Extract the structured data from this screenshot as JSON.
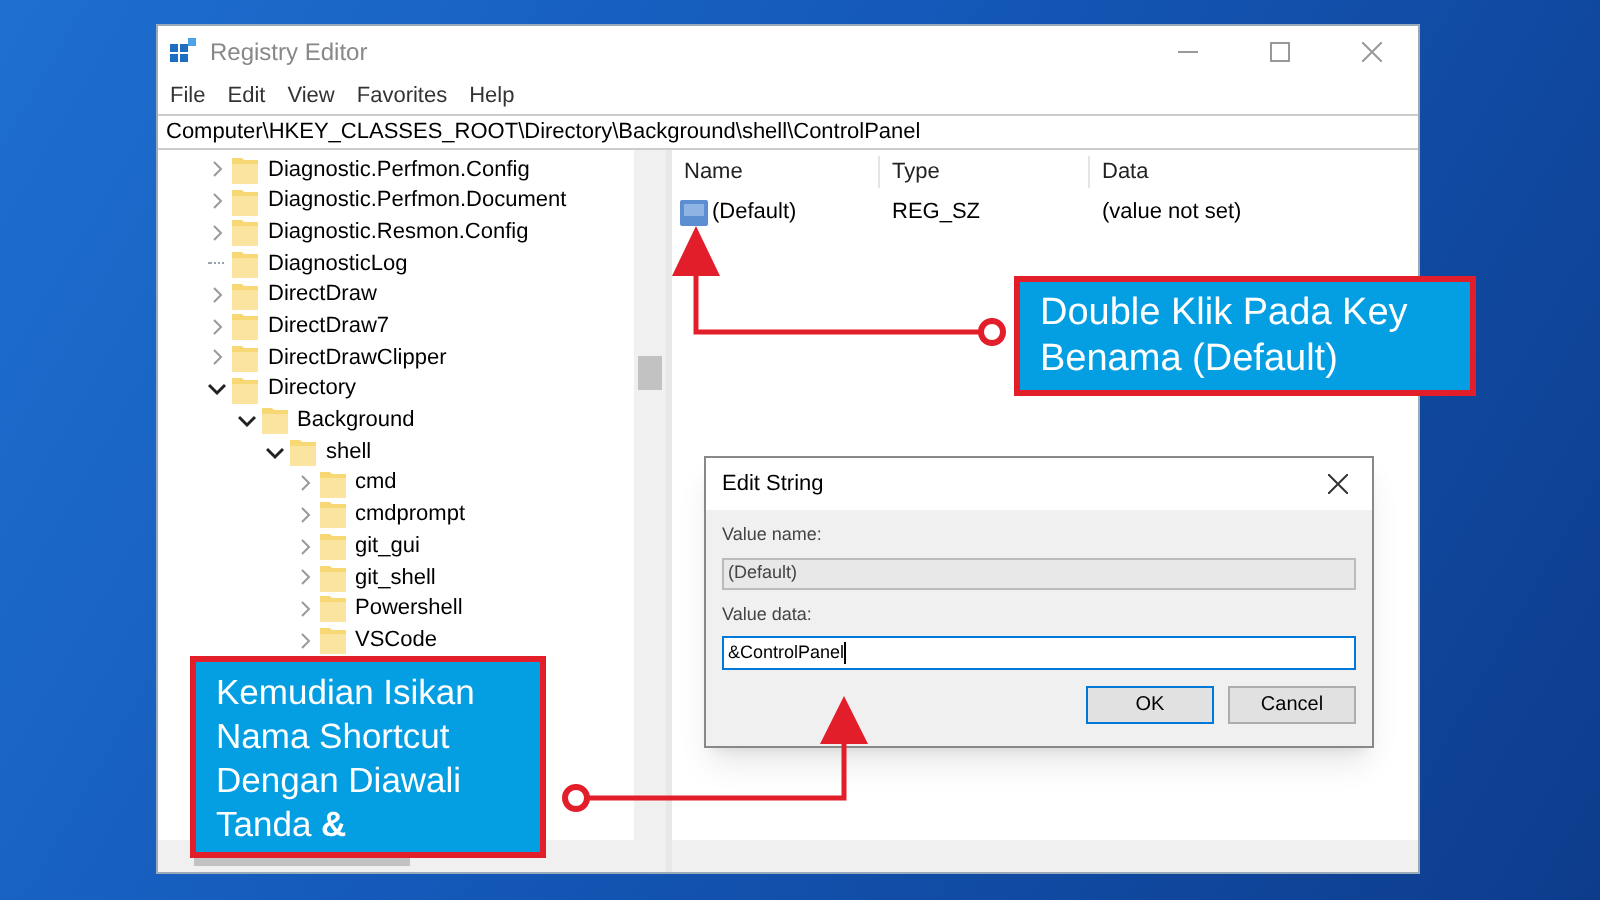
{
  "window": {
    "title": "Registry Editor"
  },
  "menu": [
    "File",
    "Edit",
    "View",
    "Favorites",
    "Help"
  ],
  "address": "Computer\\HKEY_CLASSES_ROOT\\Directory\\Background\\shell\\ControlPanel",
  "tree": [
    {
      "label": "Diagnostic.Perfmon.Config",
      "kind": "key",
      "expanded": false
    },
    {
      "label": "Diagnostic.Perfmon.Document",
      "kind": "key",
      "expanded": false
    },
    {
      "label": "Diagnostic.Resmon.Config",
      "kind": "key",
      "expanded": false
    },
    {
      "label": "DiagnosticLog",
      "kind": "leaf"
    },
    {
      "label": "DirectDraw",
      "kind": "key",
      "expanded": false
    },
    {
      "label": "DirectDraw7",
      "kind": "key",
      "expanded": false
    },
    {
      "label": "DirectDrawClipper",
      "kind": "key",
      "expanded": false
    },
    {
      "label": "Directory",
      "kind": "key",
      "expanded": true,
      "children": [
        {
          "label": "Background",
          "kind": "key",
          "expanded": true,
          "children": [
            {
              "label": "shell",
              "kind": "key",
              "expanded": true,
              "children": [
                {
                  "label": "cmd",
                  "kind": "key",
                  "expanded": false
                },
                {
                  "label": "cmdprompt",
                  "kind": "key",
                  "expanded": false
                },
                {
                  "label": "git_gui",
                  "kind": "key",
                  "expanded": false
                },
                {
                  "label": "git_shell",
                  "kind": "key",
                  "expanded": false
                },
                {
                  "label": "Powershell",
                  "kind": "key",
                  "expanded": false
                },
                {
                  "label": "VSCode",
                  "kind": "key",
                  "expanded": false
                }
              ]
            }
          ]
        }
      ]
    }
  ],
  "list": {
    "columns": [
      "Name",
      "Type",
      "Data"
    ],
    "rows": [
      {
        "name": "(Default)",
        "type": "REG_SZ",
        "data": "(value not set)"
      }
    ]
  },
  "dialog": {
    "title": "Edit String",
    "value_name_label": "Value name:",
    "value_name": "(Default)",
    "value_data_label": "Value data:",
    "value_data": "&ControlPanel",
    "buttons": [
      "OK",
      "Cancel"
    ]
  },
  "annotations": [
    "Double Klik Pada Key Benama (Default)",
    "Kemudian Isikan Nama Shortcut Dengan Diawali Tanda **&**"
  ]
}
